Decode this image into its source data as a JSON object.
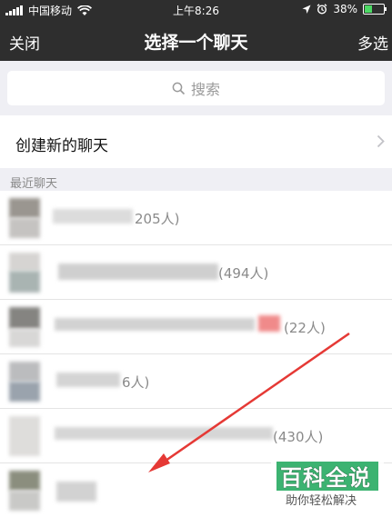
{
  "status_bar": {
    "carrier": "中国移动",
    "time": "上午8:26",
    "battery_text": "38%",
    "battery_level": 0.38,
    "icons": [
      "signal-icon",
      "wifi-icon",
      "location-icon",
      "alarm-icon",
      "battery-icon"
    ]
  },
  "nav": {
    "close_label": "关闭",
    "title": "选择一个聊天",
    "multi_label": "多选"
  },
  "search": {
    "placeholder": "搜索"
  },
  "create_chat": {
    "label": "创建新的聊天"
  },
  "recent": {
    "label": "最近聊天",
    "rows": [
      {
        "count": "205人)"
      },
      {
        "count": "(494人)"
      },
      {
        "count": "(22人)"
      },
      {
        "count": "6人)"
      },
      {
        "count": "(430人)"
      },
      {
        "count": ""
      }
    ]
  },
  "annotation": {
    "arrow_color": "#e53935"
  },
  "watermark": {
    "title": "百科全说",
    "subtitle": "助你轻松解决",
    "color": "#3cb371"
  }
}
